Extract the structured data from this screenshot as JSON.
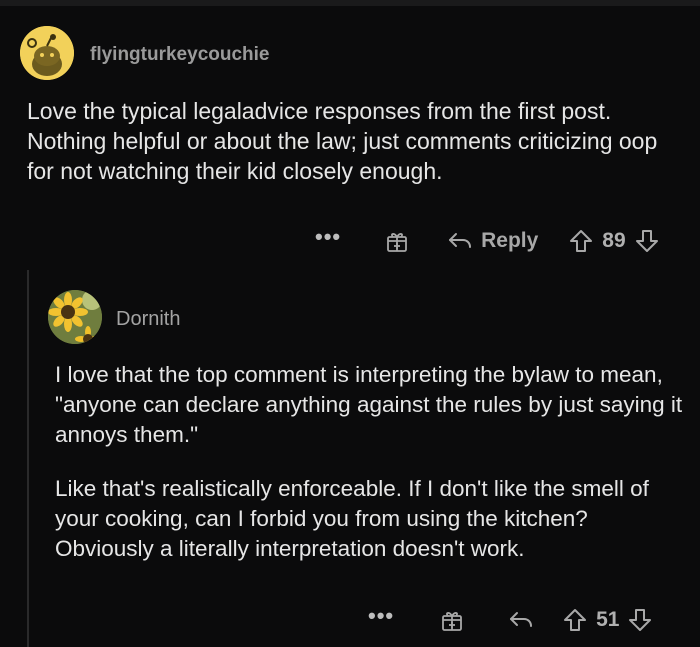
{
  "comments": [
    {
      "username": "flyingturkeycouchie",
      "avatar_icon": "snoo-avatar-icon",
      "body": "Love the typical legaladvice responses from the first post. Nothing helpful or about the law; just comments criticizing oop for not watching their kid closely enough.",
      "actions": {
        "more": "•••",
        "reply_label": "Reply",
        "votes": "89"
      }
    },
    {
      "username": "Dornith",
      "avatar_icon": "sunflower-avatar-icon",
      "paragraphs": [
        "I love that the top comment is interpreting the bylaw to mean, \"anyone can declare anything against the rules by just saying it annoys them.\"",
        "Like that's realistically enforceable. If I don't like the smell of your cooking, can I forbid you from using the kitchen? Obviously a literally interpretation doesn't work."
      ],
      "actions": {
        "more": "•••",
        "votes": "51"
      }
    }
  ],
  "colors": {
    "background": "#0b0b0c",
    "text": "#e6e6e6",
    "meta": "#9a9a9a",
    "avatar_yellow": "#f2d15a"
  }
}
